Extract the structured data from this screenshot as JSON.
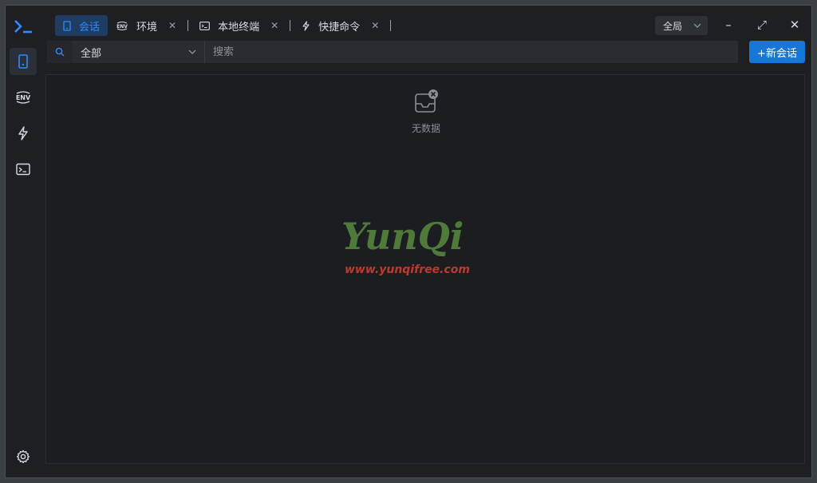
{
  "sidebar": {
    "items": [
      {
        "name": "sessions",
        "icon": "phone-icon"
      },
      {
        "name": "env",
        "icon": "env-icon",
        "label": "ENV"
      },
      {
        "name": "quick-commands",
        "icon": "lightning-icon"
      },
      {
        "name": "terminal",
        "icon": "terminal-icon"
      }
    ],
    "settings_icon": "gear-icon"
  },
  "tabs": [
    {
      "label": "会话",
      "icon": "phone-icon",
      "active": true
    },
    {
      "label": "环境",
      "icon": "env-icon",
      "close": "✕"
    },
    {
      "label": "本地终端",
      "icon": "terminal-icon",
      "close": "✕"
    },
    {
      "label": "快捷命令",
      "icon": "lightning-icon",
      "close": "✕"
    }
  ],
  "scope": {
    "value": "全局"
  },
  "window_controls": {
    "minimize": "–",
    "maximize": "⤢",
    "close": "✕"
  },
  "toolbar": {
    "filter_value": "全部",
    "search_placeholder": "搜索",
    "new_button": "+新会话"
  },
  "empty": {
    "text": "无数据"
  },
  "watermark": {
    "logo": "YunQi",
    "url": "www.yunqifree.com"
  },
  "colors": {
    "accent": "#1677d9",
    "background": "#1e1f23"
  }
}
